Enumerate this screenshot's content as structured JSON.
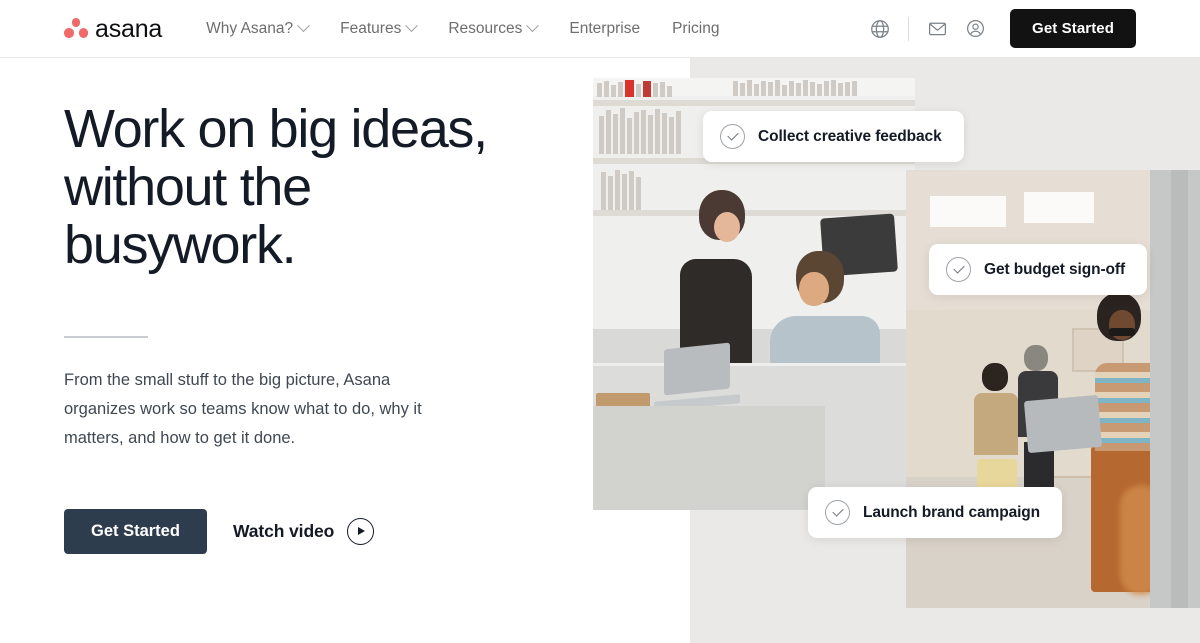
{
  "brand": {
    "name": "asana",
    "logo_icon": "asana-three-dots-logo",
    "accent_color": "#f06a6a"
  },
  "nav": {
    "links": [
      {
        "label": "Why Asana?",
        "has_dropdown": true
      },
      {
        "label": "Features",
        "has_dropdown": true
      },
      {
        "label": "Resources",
        "has_dropdown": true
      },
      {
        "label": "Enterprise",
        "has_dropdown": false
      },
      {
        "label": "Pricing",
        "has_dropdown": false
      }
    ],
    "icons": [
      {
        "name": "globe-icon",
        "title": "Language"
      },
      {
        "name": "mail-icon",
        "title": "Contact"
      },
      {
        "name": "account-icon",
        "title": "Log in"
      }
    ],
    "cta_label": "Get Started",
    "cta_color": "#121212"
  },
  "hero": {
    "headline": "Work on big ideas, without the busywork.",
    "lede": "From the small stuff to the big picture, Asana organizes work so teams know what to do, why it matters, and how to get it done.",
    "primary_cta": "Get Started",
    "primary_cta_color": "#2e3d4d",
    "video_label": "Watch video",
    "video_icon": "play-icon",
    "divider": "horizontal-rule"
  },
  "collage": {
    "background_color": "#ebe9e7",
    "photos": [
      {
        "name": "photo-office-desk-collaboration",
        "alt": "Two coworkers at a studio desk with a laptop"
      },
      {
        "name": "photo-warehouse-woman-laptop",
        "alt": "Woman holding a laptop in an open workspace"
      }
    ],
    "task_pills": [
      {
        "icon": "check-circle-icon",
        "label": "Collect creative feedback"
      },
      {
        "icon": "check-circle-icon",
        "label": "Get budget sign-off"
      },
      {
        "icon": "check-circle-icon",
        "label": "Launch brand campaign"
      }
    ]
  }
}
